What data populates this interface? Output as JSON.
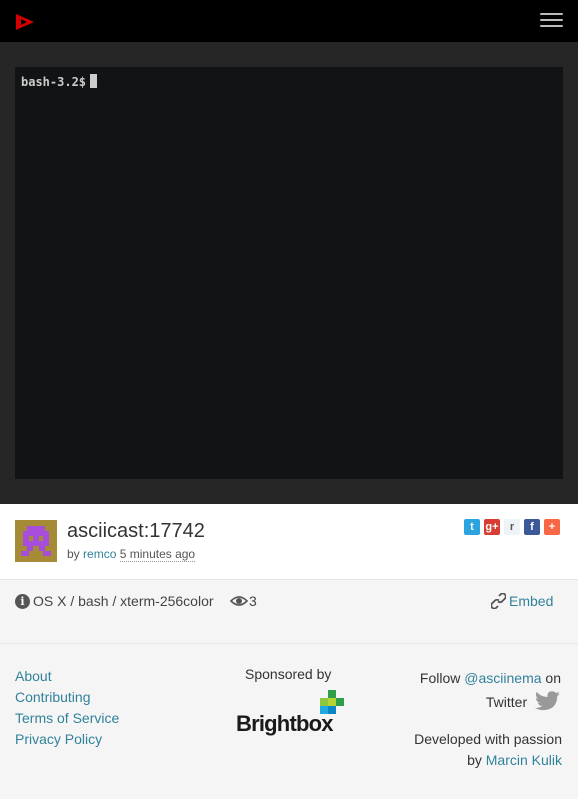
{
  "terminal": {
    "prompt": "bash-3.2$"
  },
  "asciicast": {
    "title": "asciicast:17742",
    "by_prefix": "by",
    "author": "remco",
    "time_ago": "5 minutes ago",
    "environment": "OS X / bash / xterm-256color",
    "views": "3",
    "embed_label": "Embed"
  },
  "share": {
    "twitter": "t",
    "gplus": "g+",
    "reddit": "r",
    "facebook": "f",
    "addthis": "+"
  },
  "footer": {
    "links": [
      "About",
      "Contributing",
      "Terms of Service",
      "Privacy Policy"
    ],
    "sponsored_by": "Sponsored by",
    "sponsor_name": "Brightbox",
    "follow_prefix": "Follow",
    "follow_handle": "@asciinema",
    "follow_on": "on",
    "twitter_label": "Twitter",
    "dev_line": "Developed with passion",
    "dev_by": "by",
    "dev_author": "Marcin Kulik"
  },
  "colors": {
    "accent": "#31829b",
    "logo_red": "#d40000",
    "avatar": "#a58b35",
    "avatar_icon": "#a64ddb"
  }
}
